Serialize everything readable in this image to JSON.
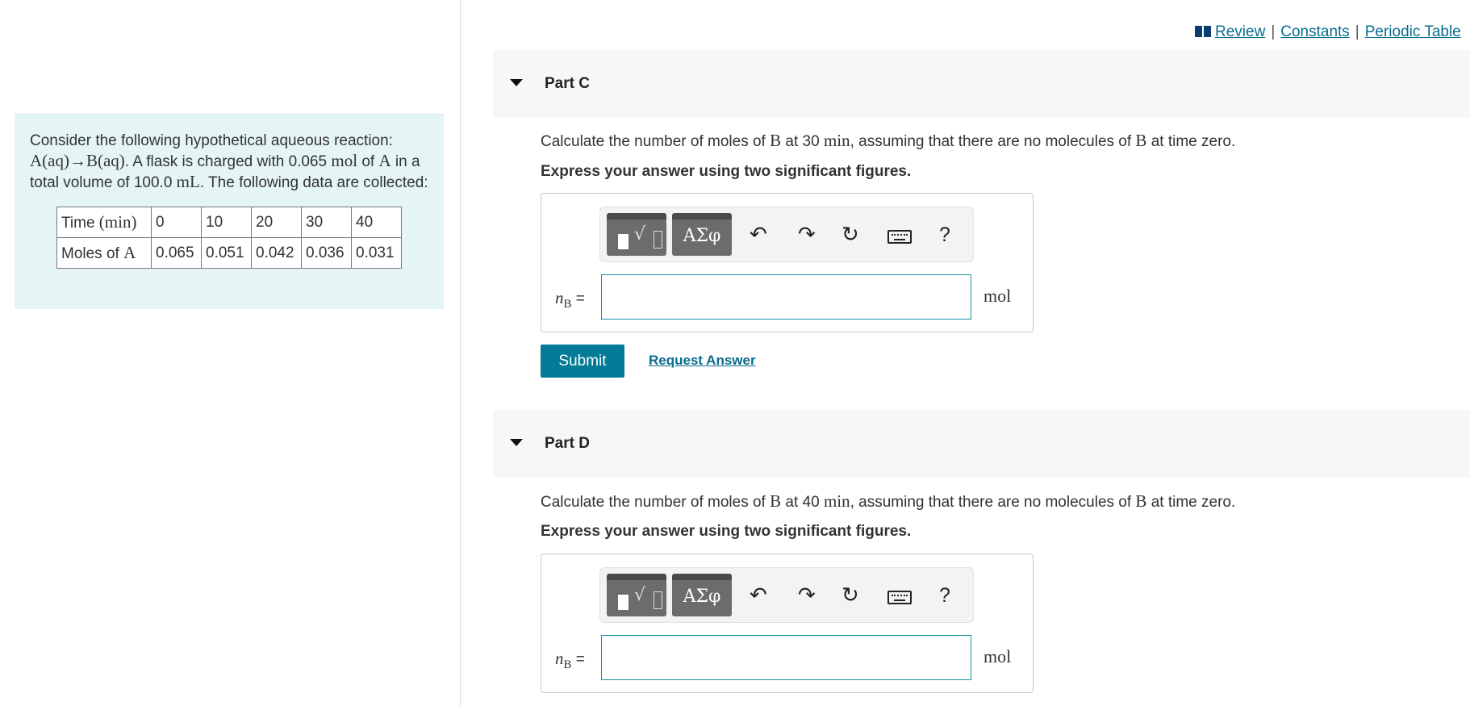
{
  "top_links": {
    "review": "Review",
    "constants": "Constants",
    "periodic_table": "Periodic Table",
    "separator": "|"
  },
  "problem": {
    "intro_pre": "Consider the following hypothetical aqueous reaction: ",
    "reaction": "A(aq)→B(aq)",
    "intro_mid1": ". A flask is charged with 0.065 ",
    "mol_unit": "mol",
    "intro_of": " of ",
    "species_a": "A",
    "intro_mid2": " in a total volume of 100.0 ",
    "ml_unit": "mL",
    "intro_end": ". The following data are collected:",
    "table": {
      "row1_label_text": "Time ",
      "row1_label_unit": "(min)",
      "times": [
        "0",
        "10",
        "20",
        "30",
        "40"
      ],
      "row2_label_text": "Moles of ",
      "row2_label_species": "A",
      "moles": [
        "0.065",
        "0.051",
        "0.042",
        "0.036",
        "0.031"
      ]
    }
  },
  "parts": [
    {
      "title": "Part C",
      "q_pre": "Calculate the number of moles of ",
      "q_species": "B",
      "q_at": " at 30 ",
      "q_unit": "min",
      "q_mid": ", assuming that there are no molecules of ",
      "q_species2": "B",
      "q_end": " at time zero.",
      "instruction": "Express your answer using two significant figures.",
      "var": "n",
      "var_sub": "B",
      "equals": "=",
      "unit": "mol",
      "input_value": ""
    },
    {
      "title": "Part D",
      "q_pre": "Calculate the number of moles of ",
      "q_species": "B",
      "q_at": " at 40 ",
      "q_unit": "min",
      "q_mid": ", assuming that there are no molecules of ",
      "q_species2": "B",
      "q_end": " at time zero.",
      "instruction": "Express your answer using two significant figures.",
      "var": "n",
      "var_sub": "B",
      "equals": "=",
      "unit": "mol",
      "input_value": ""
    }
  ],
  "toolbar": {
    "greek_label": "ΑΣφ",
    "undo_icon": "↶",
    "redo_icon": "↷",
    "reset_icon": "↻",
    "help_label": "?"
  },
  "actions": {
    "submit": "Submit",
    "request_answer": "Request Answer"
  },
  "colors": {
    "accent": "#037b96",
    "link": "#086d8e",
    "problem_bg": "#e5f5f6",
    "part_header_bg": "#f7f7f7"
  }
}
